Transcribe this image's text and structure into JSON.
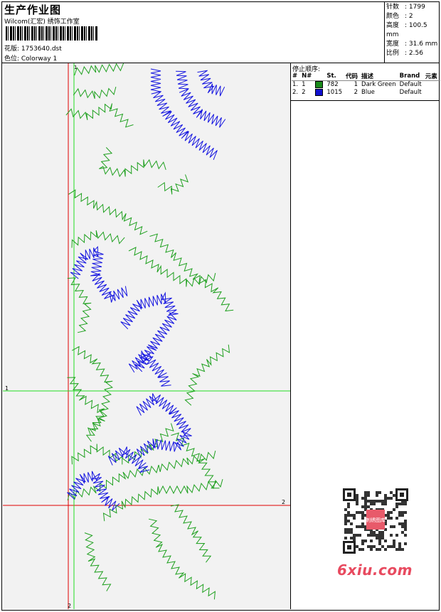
{
  "header": {
    "title": "生产作业图",
    "subtitle": "Wilcom(汇宏) 绣饰工作室",
    "design": "花版: 1753640.dst",
    "colorway": "色位: Colorway 1"
  },
  "stats": [
    {
      "k": "针数",
      "v": ": 1799"
    },
    {
      "k": "颜色",
      "v": ": 2"
    },
    {
      "k": "高度",
      "v": ": 100.5 mm"
    },
    {
      "k": "宽度",
      "v": ": 31.6 mm"
    },
    {
      "k": "比例",
      "v": ": 2.56"
    }
  ],
  "stop_sequence": {
    "title": "停止顺序:",
    "columns": [
      "#",
      "N#",
      "St.",
      "代码",
      "描述",
      "Brand",
      "元素"
    ],
    "rows": [
      {
        "num": "1.",
        "n": "1",
        "color": "#1a8a1a",
        "st": "782",
        "code": "1",
        "desc": "Dark Green",
        "brand": "Default"
      },
      {
        "num": "2.",
        "n": "2",
        "color": "#1010d0",
        "st": "1015",
        "code": "2",
        "desc": "Blue",
        "brand": "Default"
      }
    ]
  },
  "markers": {
    "green_label": "1",
    "red_label": "2"
  },
  "colors": {
    "green_thread": "#1fa01f",
    "blue_thread": "#1515e0",
    "green_guide": "#22dd22",
    "red_guide": "#e00000"
  },
  "watermark": {
    "text": "6xiu.com",
    "qr_label": "刺绣图库"
  }
}
